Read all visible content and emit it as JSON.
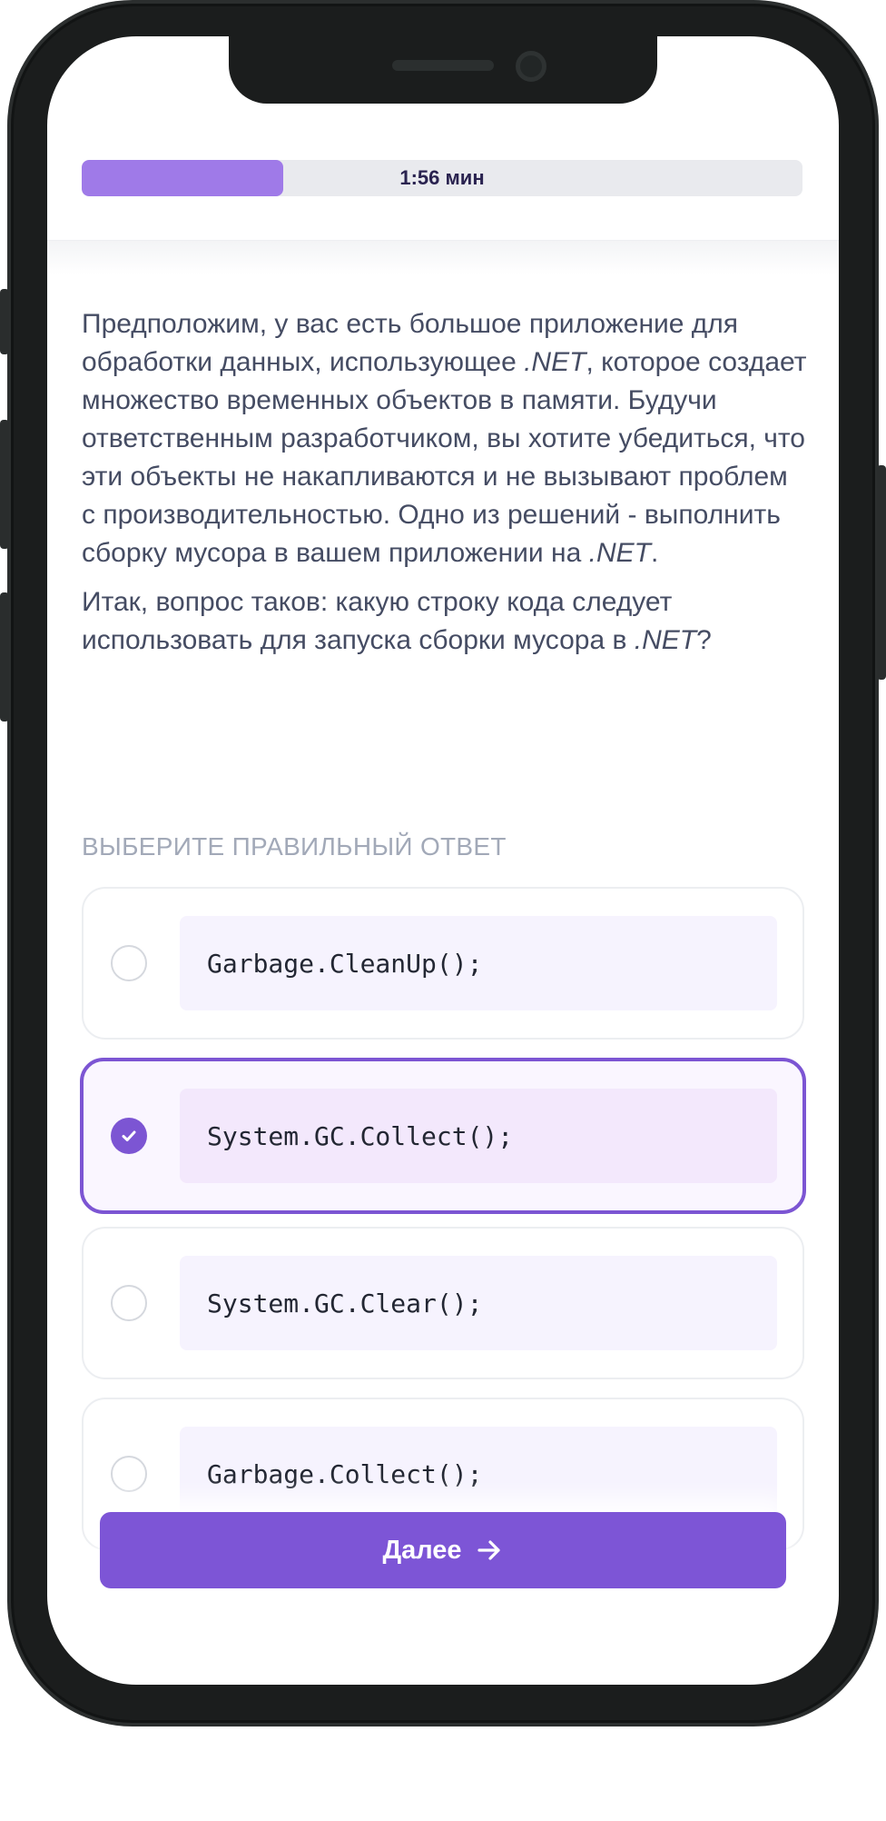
{
  "timer": {
    "label": "1:56 мин",
    "progress_fraction": 0.28
  },
  "question": {
    "paragraph1_parts": [
      "Предположим, у вас есть большое приложение для обработки данных, использующее ",
      ".NET",
      ", которое создает множество временных объектов в памяти. Будучи ответственным разработчиком, вы хотите убедиться, что эти объекты не накапливаются и не вызывают проблем с производительностью. Одно из решений - выполнить сборку мусора в вашем приложении на ",
      ".NET",
      "."
    ],
    "paragraph2_parts": [
      "Итак, вопрос таков: какую строку кода следует использовать для запуска сборки мусора в ",
      ".NET",
      "?"
    ]
  },
  "answers": {
    "section_label": "Выберите правильный ответ",
    "options": [
      {
        "code": "Garbage.CleanUp();",
        "selected": false
      },
      {
        "code": "System.GC.Collect();",
        "selected": true
      },
      {
        "code": "System.GC.Clear();",
        "selected": false
      },
      {
        "code": "Garbage.Collect();",
        "selected": false
      }
    ]
  },
  "next_button": {
    "label": "Далее",
    "icon": "arrow-right-icon"
  },
  "colors": {
    "accent": "#7d55d6",
    "timer_fill": "#9f7ae8",
    "selected_bg": "#faf6ff",
    "code_bg": "#f6f3fe"
  }
}
